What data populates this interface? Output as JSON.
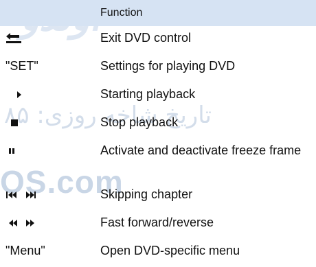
{
  "header": {
    "function_label": "Function"
  },
  "rows": [
    {
      "icon": "back-arrow-icon",
      "symbol_text": "",
      "function": "Exit DVD control"
    },
    {
      "icon": "",
      "symbol_text": "\"SET\"",
      "function": "Settings for playing DVD"
    },
    {
      "icon": "play-icon",
      "symbol_text": "",
      "function": "Starting playback"
    },
    {
      "icon": "stop-icon",
      "symbol_text": "",
      "function": "Stop playback"
    },
    {
      "icon": "pause-icon",
      "symbol_text": "",
      "function": "Activate and deactivate freeze frame"
    },
    {
      "icon": "skip-prev-next-icon",
      "symbol_text": "",
      "function": "Skipping chapter"
    },
    {
      "icon": "rewind-forward-icon",
      "symbol_text": "",
      "function": "Fast forward/reverse"
    },
    {
      "icon": "",
      "symbol_text": "\"Menu\"",
      "function": "Open DVD-specific menu"
    }
  ],
  "watermark": {
    "text_top": "اولدو",
    "text_arabic": "تاریخ شاخه روزی: ۸۵",
    "text_os": "OS.com"
  },
  "colors": {
    "header_bg": "#d6e3f3",
    "text": "#111111",
    "watermark": "#c9d6e6"
  }
}
